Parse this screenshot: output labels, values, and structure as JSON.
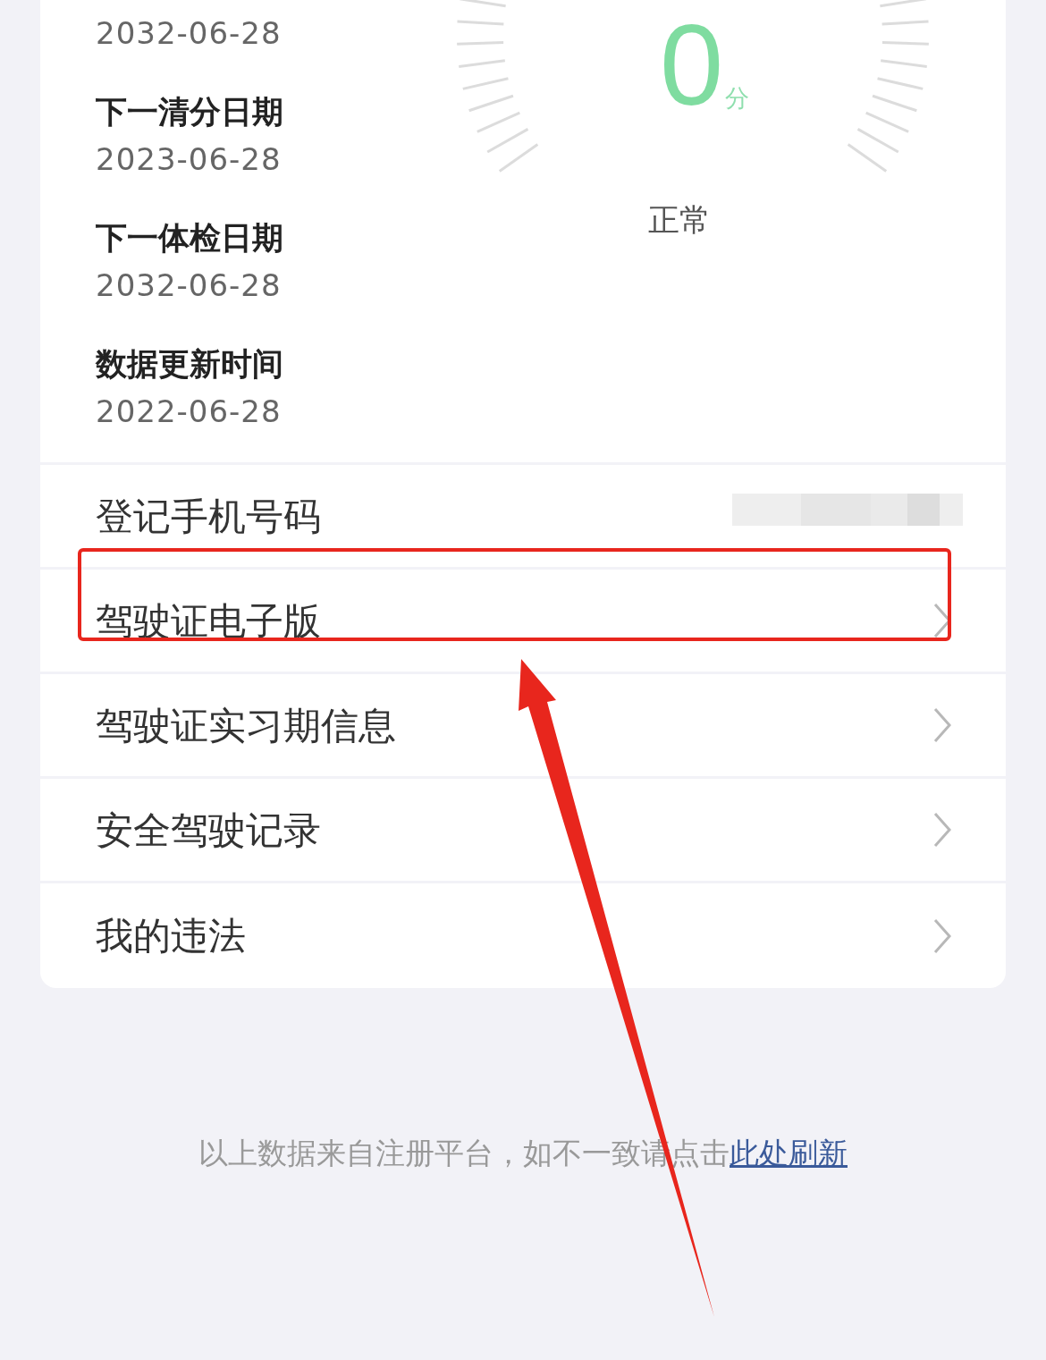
{
  "license_info": [
    {
      "date": "2032-06-28"
    },
    {
      "label": "下一清分日期",
      "date": "2023-06-28"
    },
    {
      "label": "下一体检日期",
      "date": "2032-06-28"
    },
    {
      "label": "数据更新时间",
      "date": "2022-06-28"
    }
  ],
  "score": {
    "value": "0",
    "unit": "分",
    "status": "正常"
  },
  "menu": [
    {
      "label": "登记手机号码",
      "kind": "value",
      "redacted": true,
      "highlighted": false
    },
    {
      "label": "驾驶证电子版",
      "kind": "link",
      "highlighted": true
    },
    {
      "label": "驾驶证实习期信息",
      "kind": "link",
      "highlighted": false
    },
    {
      "label": "安全驾驶记录",
      "kind": "link",
      "highlighted": false
    },
    {
      "label": "我的违法",
      "kind": "link",
      "highlighted": false
    }
  ],
  "footer": {
    "text": "以上数据来自注册平台，如不一致请点击",
    "link": "此处刷新"
  }
}
